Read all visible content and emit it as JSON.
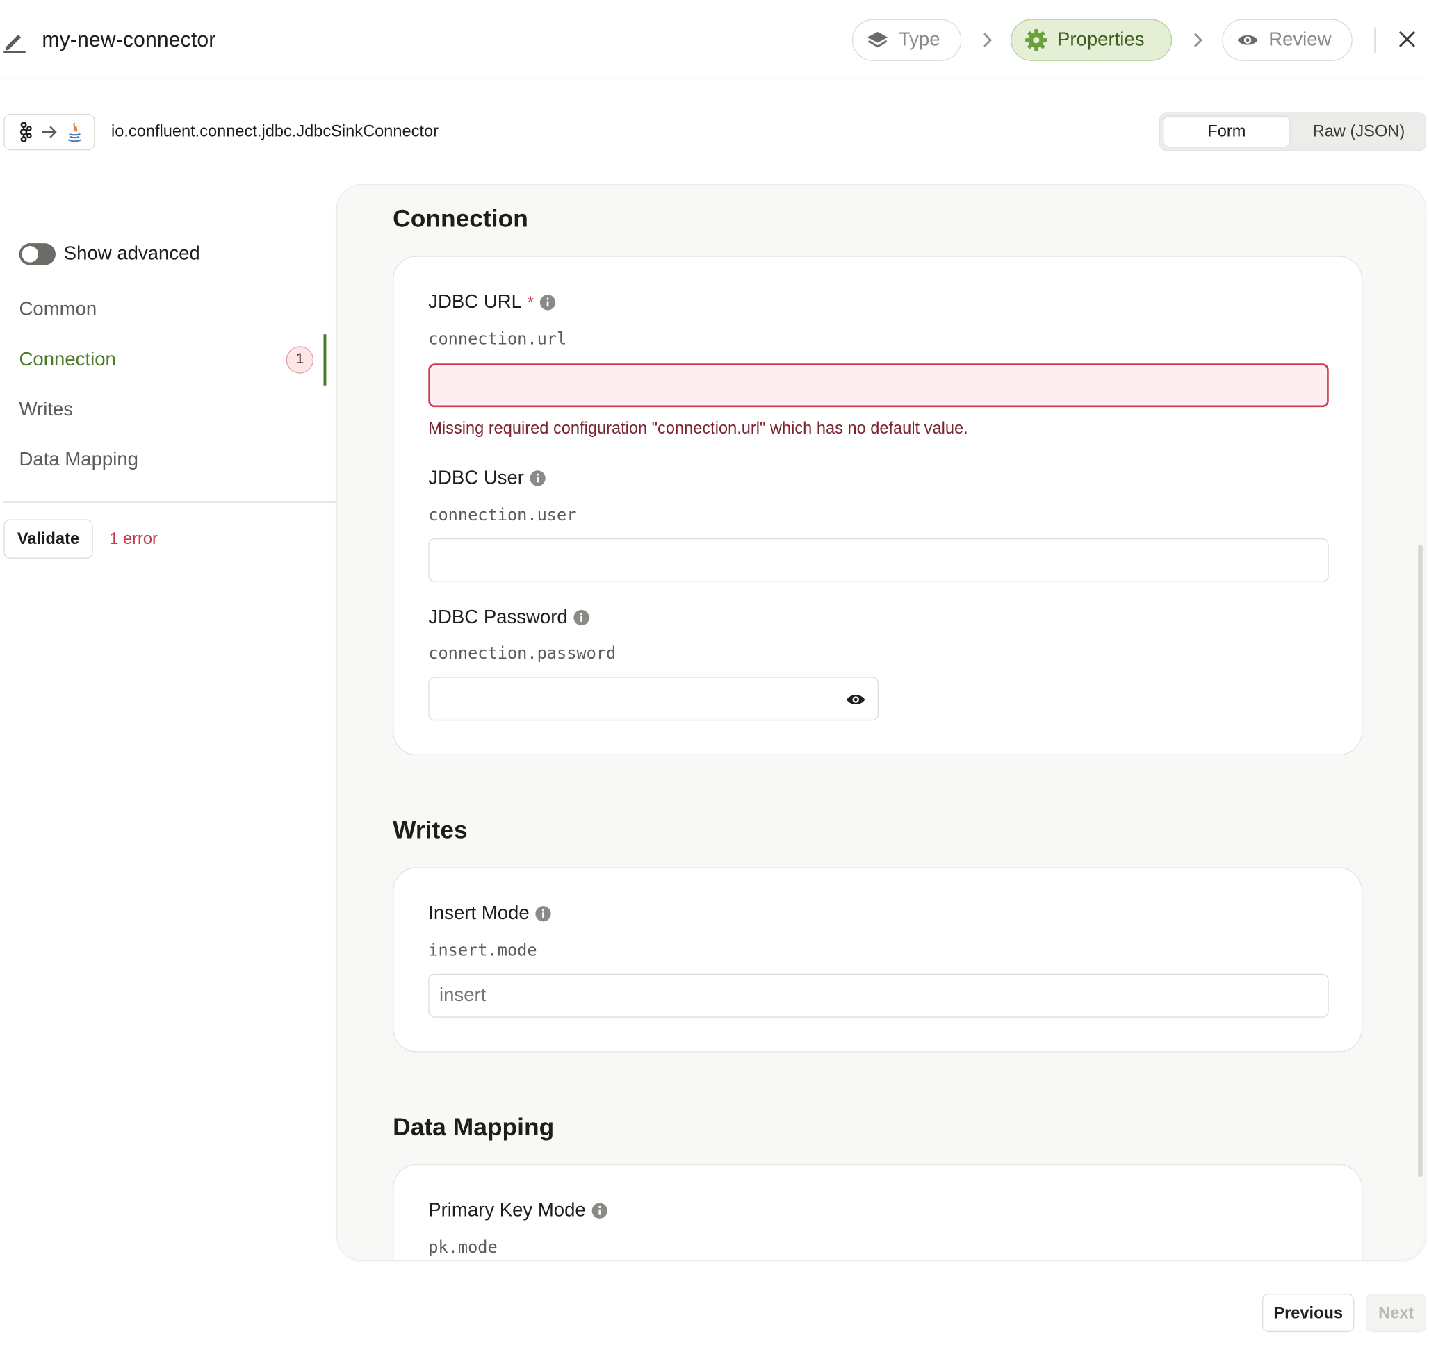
{
  "header": {
    "connector_name": "my-new-connector",
    "steps": [
      {
        "label": "Type"
      },
      {
        "label": "Properties"
      },
      {
        "label": "Review"
      }
    ]
  },
  "subheader": {
    "class_name": "io.confluent.connect.jdbc.JdbcSinkConnector",
    "mode_tabs": [
      {
        "label": "Form"
      },
      {
        "label": "Raw (JSON)"
      }
    ]
  },
  "sidebar": {
    "show_advanced_label": "Show advanced",
    "items": [
      {
        "label": "Common"
      },
      {
        "label": "Connection",
        "badge": "1"
      },
      {
        "label": "Writes"
      },
      {
        "label": "Data Mapping"
      }
    ],
    "validate_label": "Validate",
    "error_text": "1 error"
  },
  "sections": {
    "connection": {
      "title": "Connection",
      "fields": [
        {
          "label": "JDBC URL",
          "required_mark": "*",
          "key": "connection.url",
          "value": "",
          "error": "Missing required configuration \"connection.url\" which has no default value."
        },
        {
          "label": "JDBC User",
          "key": "connection.user",
          "value": ""
        },
        {
          "label": "JDBC Password",
          "key": "connection.password",
          "value": ""
        }
      ]
    },
    "writes": {
      "title": "Writes",
      "fields": [
        {
          "label": "Insert Mode",
          "key": "insert.mode",
          "placeholder": "insert"
        }
      ]
    },
    "data_mapping": {
      "title": "Data Mapping",
      "fields": [
        {
          "label": "Primary Key Mode",
          "key": "pk.mode"
        }
      ]
    }
  },
  "footer": {
    "previous_label": "Previous",
    "next_label": "Next"
  },
  "colors": {
    "accent": "#4a7a24",
    "accent_bg": "#e4efd6",
    "error": "#c23a48",
    "error_bg": "#fdeff1"
  }
}
